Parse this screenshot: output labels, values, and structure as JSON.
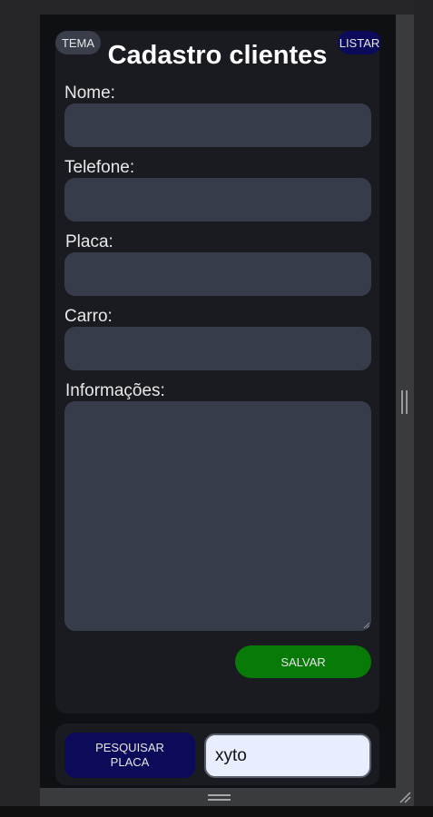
{
  "header": {
    "theme_button": "TEMA",
    "list_button": "LISTAR",
    "title": "Cadastro clientes"
  },
  "form": {
    "name_label": "Nome:",
    "phone_label": "Telefone:",
    "plate_label": "Placa:",
    "car_label": "Carro:",
    "info_label": "Informações:",
    "name_value": "",
    "phone_value": "",
    "plate_value": "",
    "car_value": "",
    "info_value": "",
    "save_button": "SALVAR"
  },
  "search": {
    "button_label": "PESQUISAR PLACA",
    "input_value": "xyto"
  },
  "colors": {
    "background": "#0f1013",
    "card": "#1a1b20",
    "field": "#373c4b",
    "save": "#087a08",
    "navy": "#0c0b5a",
    "search_input": "#e8eefe"
  }
}
